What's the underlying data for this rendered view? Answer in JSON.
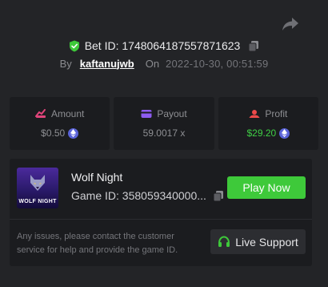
{
  "header": {
    "bet_label": "Bet ID: 1748064187557871623",
    "by_label": "By",
    "username": "kaftanujwb",
    "on_label": "On",
    "date": "2022-10-30, 00:51:59"
  },
  "stats": [
    {
      "label": "Amount",
      "value": "$0.50",
      "icon": "amount-icon",
      "currency_icon": "ethereum-icon"
    },
    {
      "label": "Payout",
      "value": "59.0017 x",
      "icon": "wallet-icon"
    },
    {
      "label": "Profit",
      "value": "$29.20",
      "icon": "profit-icon",
      "currency_icon": "ethereum-icon"
    }
  ],
  "game": {
    "name": "Wolf Night",
    "id_label": "Game ID: 358059340000...",
    "thumb_caption": "WOLF NIGHT",
    "play_label": "Play Now"
  },
  "support": {
    "message": "Any issues, please contact the customer service for help and provide the game ID.",
    "button_label": "Live Support"
  },
  "colors": {
    "background": "#232427",
    "card": "#1b1c1f",
    "accent_green": "#3ec93a",
    "profit_green": "#3fcf45",
    "eth_purple": "#5a63d8",
    "amount_icon": "#e0447a",
    "payout_icon": "#8e5cf0",
    "profit_icon": "#ec4a4a"
  }
}
